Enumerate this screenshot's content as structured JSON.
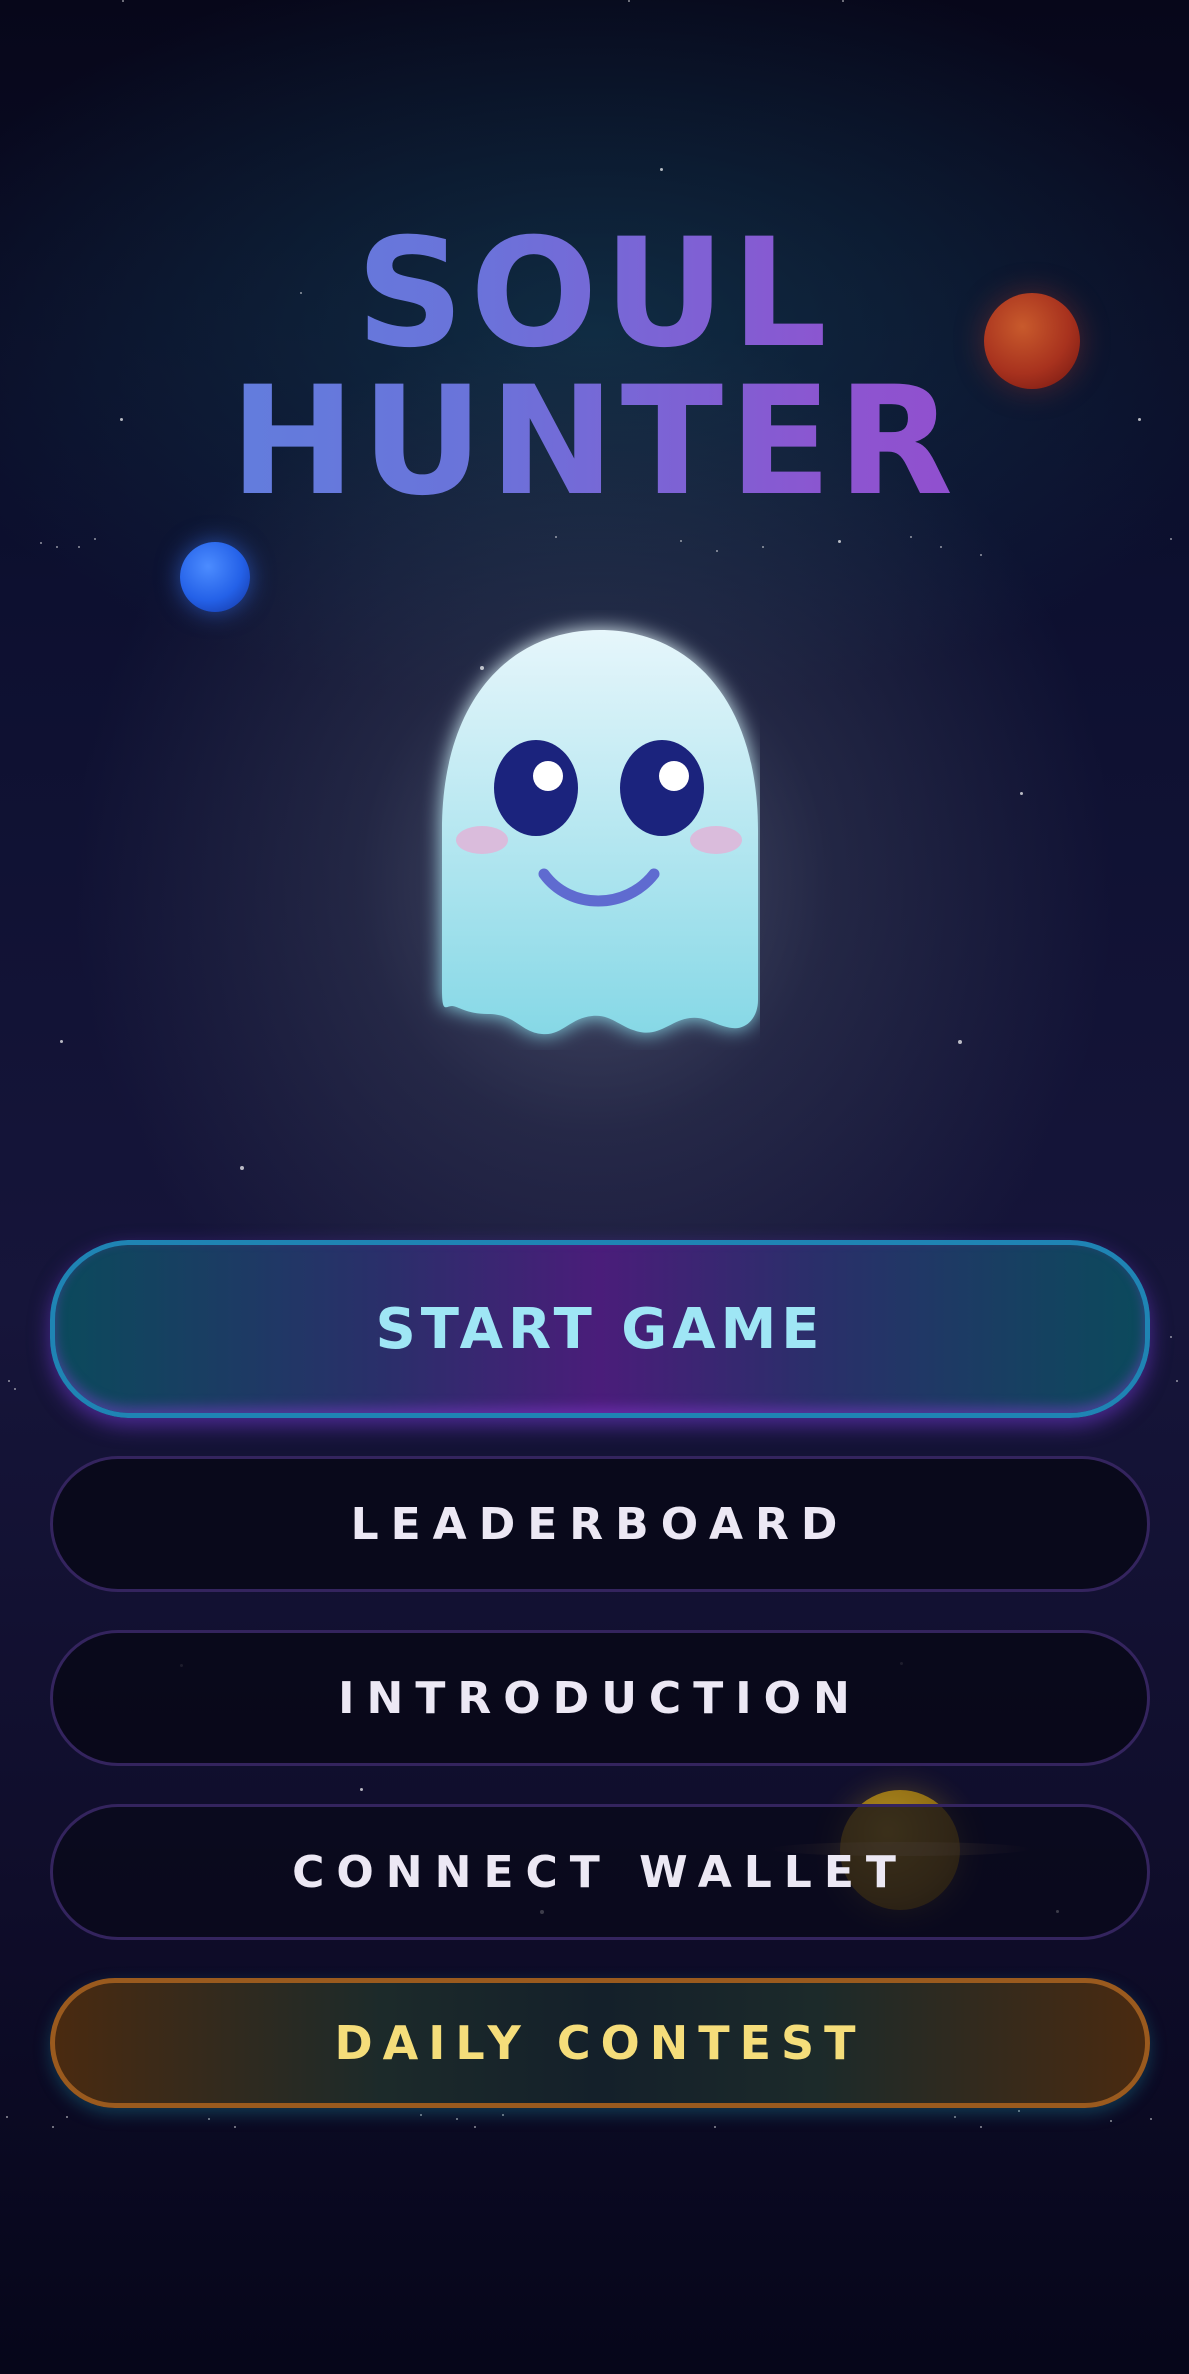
{
  "game": {
    "title_line1": "SOUL",
    "title_line2": "HUNTER"
  },
  "mascot": {
    "icon": "ghost-icon",
    "colors": {
      "body_top": "#e6f6fb",
      "body_bottom": "#86d8e6",
      "eyes": "#1b237d",
      "smile": "#5f6bd0",
      "cheeks": "#e0b4d8"
    }
  },
  "menu": {
    "start_label": "START GAME",
    "leaderboard_label": "LEADERBOARD",
    "introduction_label": "INTRODUCTION",
    "wallet_label": "CONNECT WALLET",
    "contest_label": "DAILY CONTEST"
  },
  "decorations": {
    "planets": [
      "red-planet-icon",
      "blue-planet-icon",
      "gold-planet-icon"
    ],
    "stars": "star-field"
  },
  "colors": {
    "background": "#07071a",
    "title_gradient_start": "#5b86e0",
    "title_gradient_end": "#9a45cc",
    "start_border": "#1f84b4",
    "start_text": "#9fe6f5",
    "menu_border": "#34245e",
    "menu_text": "#ece8f4",
    "contest_border": "#9a5a1e",
    "contest_text": "#f5dd7a"
  }
}
